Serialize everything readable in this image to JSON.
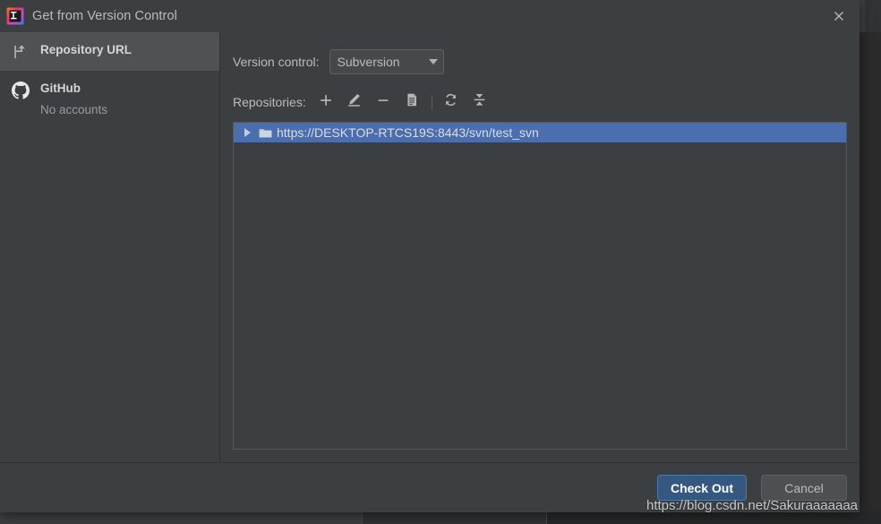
{
  "window": {
    "title": "Get from Version Control",
    "app_icon": "intellij-idea-icon",
    "close_label": "Close"
  },
  "sidebar": {
    "items": [
      {
        "id": "repository-url",
        "label": "Repository URL",
        "icon": "vcs-branch-icon",
        "subtitle": "",
        "selected": true
      },
      {
        "id": "github",
        "label": "GitHub",
        "icon": "github-icon",
        "subtitle": "No accounts",
        "selected": false
      }
    ]
  },
  "main": {
    "version_control": {
      "label": "Version control:",
      "selected": "Subversion",
      "options": [
        "Subversion"
      ]
    },
    "repositories": {
      "label": "Repositories:",
      "toolbar": [
        {
          "id": "add",
          "icon": "plus-icon",
          "tooltip": "Add Repository"
        },
        {
          "id": "edit",
          "icon": "pencil-icon",
          "tooltip": "Edit Repository"
        },
        {
          "id": "remove",
          "icon": "minus-icon",
          "tooltip": "Remove Repository"
        },
        {
          "id": "details",
          "icon": "document-icon",
          "tooltip": "Repository Details"
        },
        {
          "id": "refresh",
          "icon": "refresh-icon",
          "tooltip": "Refresh"
        },
        {
          "id": "collapse-all",
          "icon": "collapse-all-icon",
          "tooltip": "Collapse All"
        }
      ],
      "rows": [
        {
          "url": "https://DESKTOP-RTCS19S:8443/svn/test_svn",
          "expander": "triangle-right",
          "icon": "folder-icon",
          "selected": true,
          "expanded": false
        }
      ]
    }
  },
  "footer": {
    "primary_button": "Check Out",
    "secondary_button": "Cancel"
  },
  "watermark": {
    "text": "https://blog.csdn.net/Sakuraaaaaaa"
  },
  "colors": {
    "dialog_bg": "#3c3f41",
    "selection_blue": "#4b6eaf",
    "primary_button": "#365880",
    "sidebar_selected": "#4e5254",
    "text": "#bbbbbb"
  }
}
